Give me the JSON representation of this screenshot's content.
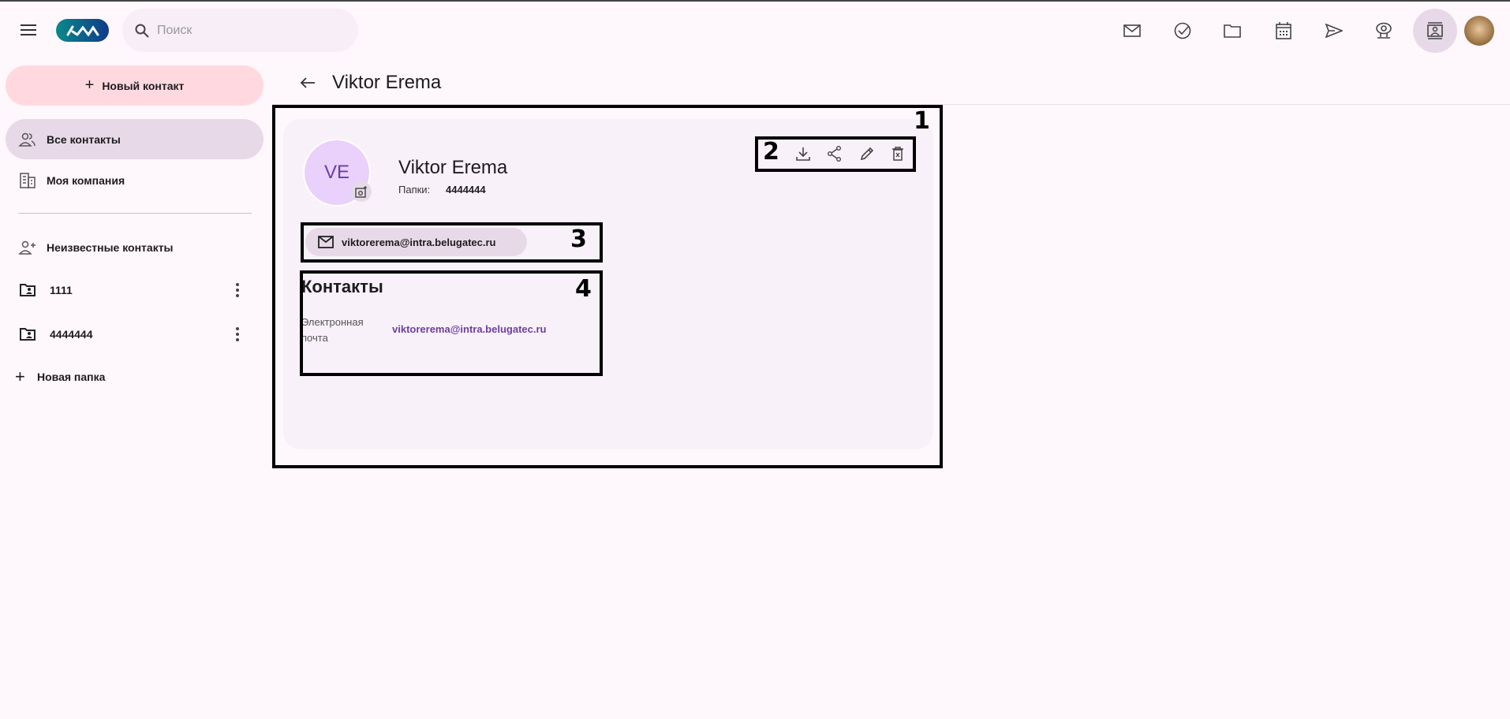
{
  "topbar": {
    "search_placeholder": "Поиск",
    "logo_text": "km",
    "icons": [
      "mail-icon",
      "tasks-icon",
      "folder-icon",
      "calendar-icon",
      "send-icon",
      "webcam-icon",
      "contacts-icon"
    ]
  },
  "sidebar": {
    "new_contact": "Новый контакт",
    "items": [
      {
        "label": "Все контакты"
      },
      {
        "label": "Моя компания"
      },
      {
        "label": "Неизвестные контакты"
      }
    ],
    "folders": [
      {
        "label": "1111"
      },
      {
        "label": "4444444"
      }
    ],
    "new_folder": "Новая папка"
  },
  "header": {
    "title": "Viktor Erema"
  },
  "contact": {
    "initials": "VE",
    "name": "Viktor Erema",
    "folders_label": "Папки:",
    "folders_value": "4444444",
    "email_chip": "viktorerema@intra.belugatec.ru",
    "section_title": "Контакты",
    "email_label": "Электронная почта",
    "email_value": "viktorerema@intra.belugatec.ru"
  },
  "annotations": [
    "1",
    "2",
    "3",
    "4"
  ],
  "colors": {
    "accent": "#6b3fa0",
    "selected": "#e8d9e8",
    "new_button": "#ffd9df",
    "avatar": "#e9d1fb"
  }
}
